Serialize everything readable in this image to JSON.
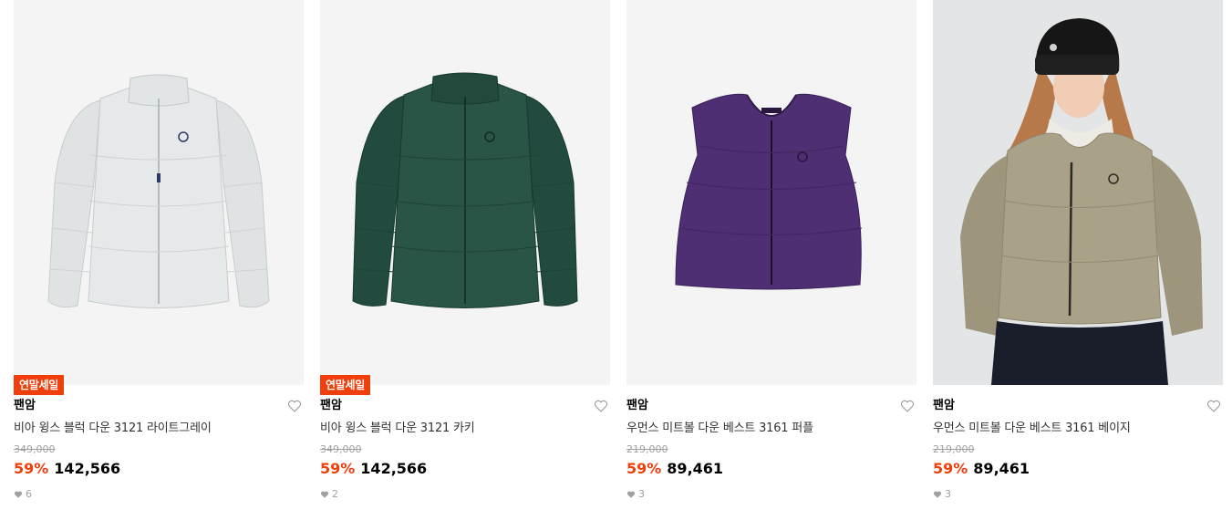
{
  "colors": {
    "accent": "#f03f0b",
    "muted": "#a0a0a0",
    "thumb_bg": "#f4f4f4"
  },
  "products": [
    {
      "badge": "연말세일",
      "brand": "팬암",
      "name": "비아 윙스 블럭 다운 3121 라이트그레이",
      "original_price": "349,000",
      "discount": "59%",
      "price": "142,566",
      "likes": "6",
      "item_color": "light-gray"
    },
    {
      "badge": "연말세일",
      "brand": "팬암",
      "name": "비아 윙스 블럭 다운 3121 카키",
      "original_price": "349,000",
      "discount": "59%",
      "price": "142,566",
      "likes": "2",
      "item_color": "dark-green"
    },
    {
      "brand": "팬암",
      "name": "우먼스 미트볼 다운 베스트 3161 퍼플",
      "original_price": "219,000",
      "discount": "59%",
      "price": "89,461",
      "likes": "3",
      "item_color": "purple"
    },
    {
      "brand": "팬암",
      "name": "우먼스 미트볼 다운 베스트 3161 베이지",
      "original_price": "219,000",
      "discount": "59%",
      "price": "89,461",
      "likes": "3",
      "item_color": "beige"
    }
  ],
  "icons": {
    "like": "heart-outline-icon",
    "like_count": "heart-filled-icon"
  }
}
